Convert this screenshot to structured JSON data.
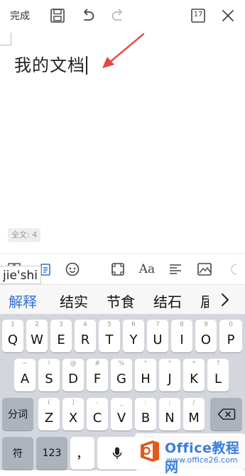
{
  "toolbar": {
    "done_label": "完成",
    "icons": [
      "save-icon",
      "undo-icon",
      "redo-icon",
      "page-count-icon",
      "close-icon"
    ],
    "page_count": "17"
  },
  "document": {
    "text": "我的文档",
    "word_count": "全文: 4",
    "annotation_color": "#e8453c"
  },
  "format_toolbar": {
    "icons": [
      "layout-icon",
      "clipboard-icon",
      "emoji-icon",
      "fullscreen-icon",
      "font-icon",
      "align-icon",
      "image-icon",
      "more-icon"
    ],
    "font_label": "Aa"
  },
  "ime": {
    "pinyin": "jie'shi",
    "candidates": [
      "解释",
      "结实",
      "节食",
      "结石",
      "届"
    ],
    "selected_index": 0,
    "more_icon": "chevron-right-icon"
  },
  "keyboard": {
    "row1": [
      {
        "main": "Q",
        "sub": "1"
      },
      {
        "main": "W",
        "sub": "2"
      },
      {
        "main": "E",
        "sub": "3"
      },
      {
        "main": "R",
        "sub": "4"
      },
      {
        "main": "T",
        "sub": "5"
      },
      {
        "main": "Y",
        "sub": "6"
      },
      {
        "main": "U",
        "sub": "7"
      },
      {
        "main": "I",
        "sub": "8"
      },
      {
        "main": "O",
        "sub": "9"
      },
      {
        "main": "P",
        "sub": "0"
      }
    ],
    "row2": [
      {
        "main": "A",
        "sub": "~"
      },
      {
        "main": "S",
        "sub": "!"
      },
      {
        "main": "D",
        "sub": "@"
      },
      {
        "main": "F",
        "sub": "#"
      },
      {
        "main": "G",
        "sub": "%"
      },
      {
        "main": "H",
        "sub": "\""
      },
      {
        "main": "J",
        "sub": "\""
      },
      {
        "main": "K",
        "sub": "*"
      },
      {
        "main": "L",
        "sub": "?"
      }
    ],
    "row3": [
      {
        "main": "Z",
        "sub": "("
      },
      {
        "main": "X",
        "sub": ")"
      },
      {
        "main": "C",
        "sub": "-"
      },
      {
        "main": "V",
        "sub": "_"
      },
      {
        "main": "B",
        "sub": ":"
      },
      {
        "main": "N",
        "sub": ";"
      },
      {
        "main": "M",
        "sub": "/"
      }
    ],
    "segment_label": "分词",
    "symbol_label": "符",
    "numeric_label": "123",
    "comma_label": "，",
    "backspace_icon": "backspace-icon",
    "mic_icon": "microphone-icon"
  },
  "watermark": {
    "title": "Office教程网",
    "url": "www.office26.com"
  }
}
